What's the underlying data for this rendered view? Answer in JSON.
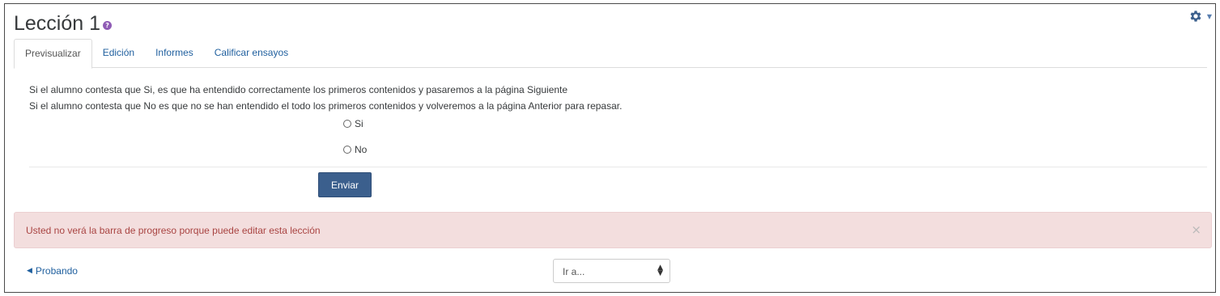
{
  "header": {
    "title": "Lección 1",
    "help_glyph": "?"
  },
  "actions": {
    "gear_icon": "gear-icon",
    "caret_icon": "chevron-down-icon"
  },
  "tabs": [
    {
      "label": "Previsualizar",
      "active": true
    },
    {
      "label": "Edición",
      "active": false
    },
    {
      "label": "Informes",
      "active": false
    },
    {
      "label": "Calificar ensayos",
      "active": false
    }
  ],
  "question": {
    "line1": "Si el alumno contesta que Si, es que ha entendido correctamente los primeros contenidos y pasaremos a la página Siguiente",
    "line2": "Si el alumno contesta que No es que no se han entendido el todo los primeros contenidos y volveremos a la página Anterior para repasar.",
    "options": [
      {
        "label": "Si",
        "checked": false
      },
      {
        "label": "No",
        "checked": false
      }
    ],
    "submit_label": "Enviar"
  },
  "alert": {
    "text": "Usted no verá la barra de progreso porque puede editar esta lección",
    "close_glyph": "×"
  },
  "navigation": {
    "prev_label": "Probando",
    "jump_selected": "Ir a..."
  },
  "colors": {
    "link": "#1f5f9e",
    "button": "#3b5f8d",
    "alert_bg": "#f3dede",
    "alert_text": "#a94442",
    "help": "#8f5bb5"
  }
}
